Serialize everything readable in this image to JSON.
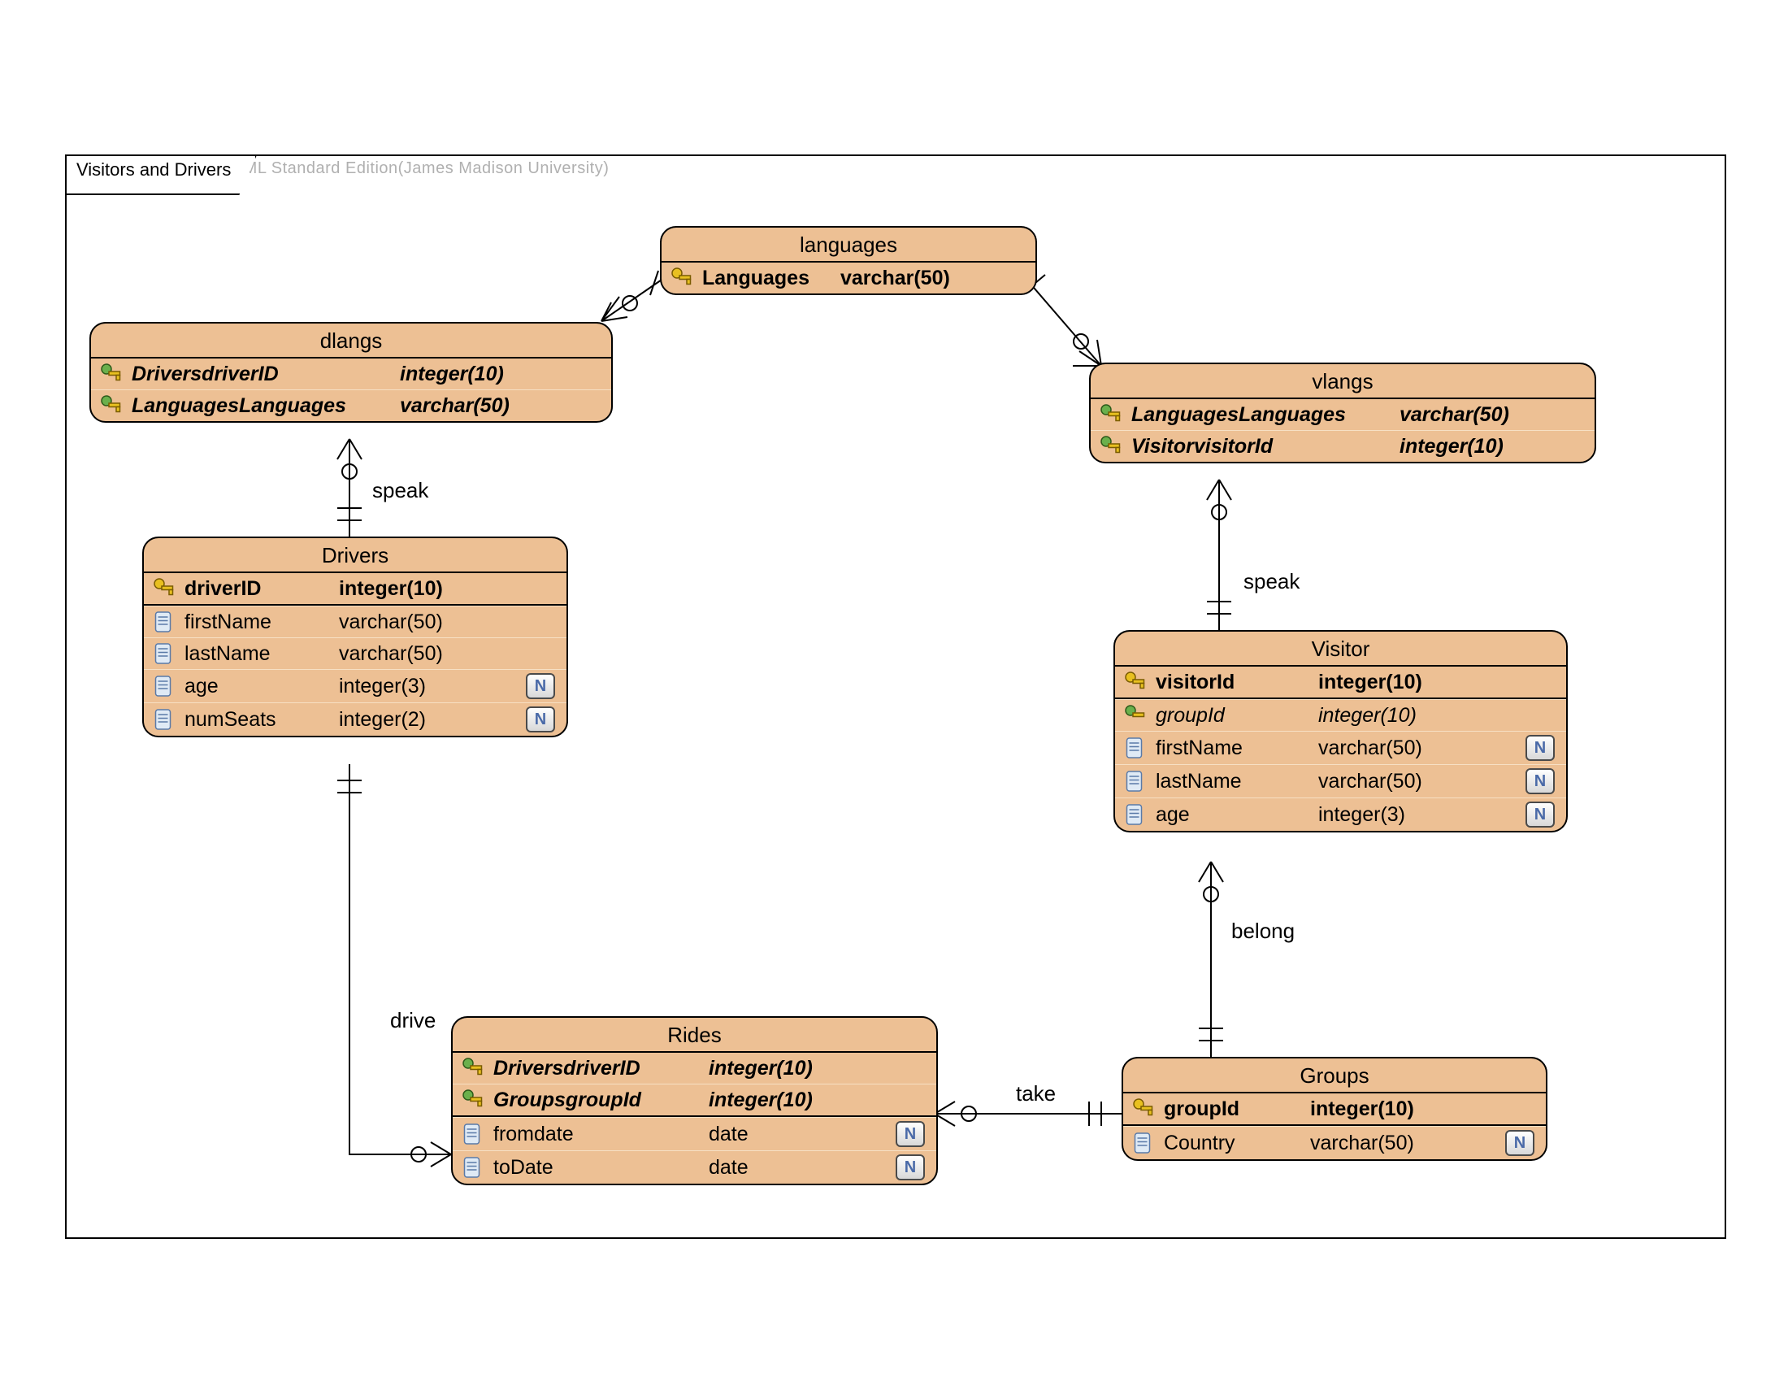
{
  "watermark": "Visual Paradigm for UML Standard Edition(James Madison University)",
  "frame": {
    "title": "Visitors and Drivers"
  },
  "entities": {
    "languages": {
      "title": "languages",
      "rows": [
        {
          "icon": "pk",
          "name": "Languages",
          "type": "varchar(50)",
          "bold": true
        }
      ]
    },
    "dlangs": {
      "title": "dlangs",
      "rows": [
        {
          "icon": "fk",
          "name": "DriversdriverID",
          "type": "integer(10)",
          "bold": true,
          "italic": true
        },
        {
          "icon": "fk",
          "name": "LanguagesLanguages",
          "type": "varchar(50)",
          "bold": true,
          "italic": true
        }
      ]
    },
    "vlangs": {
      "title": "vlangs",
      "rows": [
        {
          "icon": "fk",
          "name": "LanguagesLanguages",
          "type": "varchar(50)",
          "bold": true,
          "italic": true
        },
        {
          "icon": "fk",
          "name": "VisitorvisitorId",
          "type": "integer(10)",
          "bold": true,
          "italic": true
        }
      ]
    },
    "drivers": {
      "title": "Drivers",
      "rows": [
        {
          "icon": "pk",
          "name": "driverID",
          "type": "integer(10)",
          "bold": true
        },
        {
          "icon": "col",
          "name": "firstName",
          "type": "varchar(50)"
        },
        {
          "icon": "col",
          "name": "lastName",
          "type": "varchar(50)"
        },
        {
          "icon": "col",
          "name": "age",
          "type": "integer(3)",
          "null": true
        },
        {
          "icon": "col",
          "name": "numSeats",
          "type": "integer(2)",
          "null": true
        }
      ]
    },
    "visitor": {
      "title": "Visitor",
      "rows": [
        {
          "icon": "pk",
          "name": "visitorId",
          "type": "integer(10)",
          "bold": true
        },
        {
          "icon": "fk",
          "name": "groupId",
          "type": "integer(10)",
          "italic": true
        },
        {
          "icon": "col",
          "name": "firstName",
          "type": "varchar(50)",
          "null": true
        },
        {
          "icon": "col",
          "name": "lastName",
          "type": "varchar(50)",
          "null": true
        },
        {
          "icon": "col",
          "name": "age",
          "type": "integer(3)",
          "null": true
        }
      ]
    },
    "rides": {
      "title": "Rides",
      "rows": [
        {
          "icon": "fk",
          "name": "DriversdriverID",
          "type": "integer(10)",
          "bold": true,
          "italic": true
        },
        {
          "icon": "fk",
          "name": "GroupsgroupId",
          "type": "integer(10)",
          "bold": true,
          "italic": true
        },
        {
          "icon": "col",
          "name": "fromdate",
          "type": "date",
          "null": true
        },
        {
          "icon": "col",
          "name": "toDate",
          "type": "date",
          "null": true
        }
      ]
    },
    "groups": {
      "title": "Groups",
      "rows": [
        {
          "icon": "pk",
          "name": "groupId",
          "type": "integer(10)",
          "bold": true
        },
        {
          "icon": "col",
          "name": "Country",
          "type": "varchar(50)",
          "null": true
        }
      ]
    }
  },
  "relations": {
    "speak1": "speak",
    "speak2": "speak",
    "drive": "drive",
    "take": "take",
    "belong": "belong"
  },
  "icons": {
    "pk": "primary-key-icon",
    "fk": "foreign-key-icon",
    "col": "column-icon",
    "null": "N"
  }
}
